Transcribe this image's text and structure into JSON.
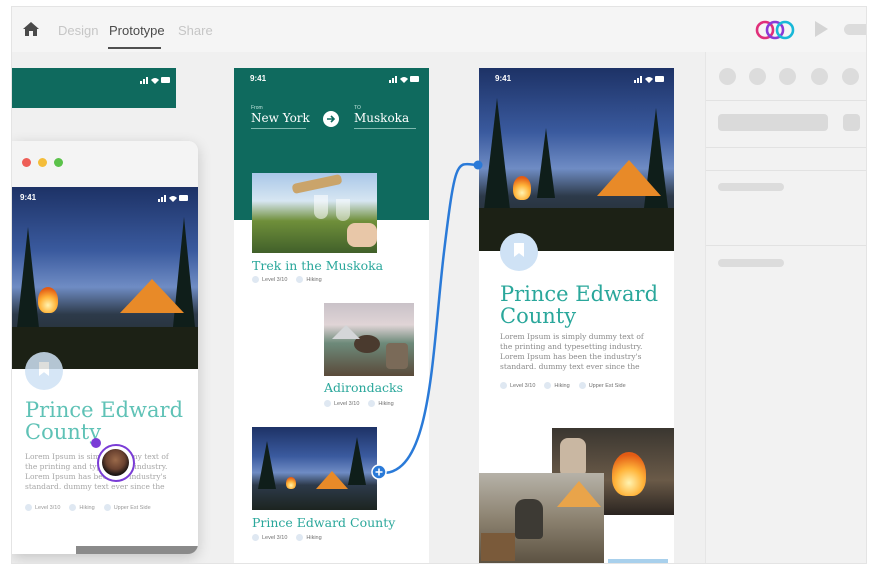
{
  "topbar": {
    "tabs": [
      {
        "label": "Design"
      },
      {
        "label": "Prototype"
      },
      {
        "label": "Share"
      }
    ]
  },
  "status": {
    "time": "9:41"
  },
  "route": {
    "from_label": "From",
    "from_city": "New York",
    "to_label": "TO",
    "to_city": "Muskoka"
  },
  "cards": [
    {
      "title": "Trek in the Muskoka",
      "level": "Level 3/10",
      "activity": "Hiking"
    },
    {
      "title": "Adirondacks",
      "level": "Level 3/10",
      "activity": "Hiking"
    },
    {
      "title": "Prince Edward County",
      "level": "Level 3/10",
      "activity": "Hiking"
    }
  ],
  "detail": {
    "title_line1": "Prince Edward",
    "title_line2": "County",
    "body": "Lorem Ipsum is simply dummy text of the printing and typesetting industry. Lorem Ipsum has been the industry's standard. dummy text ever since the",
    "level": "Level 3/10",
    "activity": "Hiking",
    "location": "Upper Est Side"
  },
  "mac_detail": {
    "title_line1": "Prince Edward",
    "title_line2": "County",
    "body_lines": [
      "Lorem Ipsum is simply dummy text of",
      "the printing and typesetting industry.",
      "Lorem Ipsum has been the industry's",
      "standard. dummy text ever since the"
    ],
    "level": "Level 3/10",
    "activity": "Hiking",
    "location": "Upper Est Side"
  },
  "colors": {
    "teal": "#0f6a5e",
    "headline": "#2aa79b",
    "wire": "#2a7ad8",
    "cursor_dot": "#7a3cd6"
  },
  "icons": [
    "home-icon",
    "coediting-users-icon",
    "play-icon",
    "bookmark-icon",
    "arrow-right-icon",
    "plus-icon"
  ]
}
